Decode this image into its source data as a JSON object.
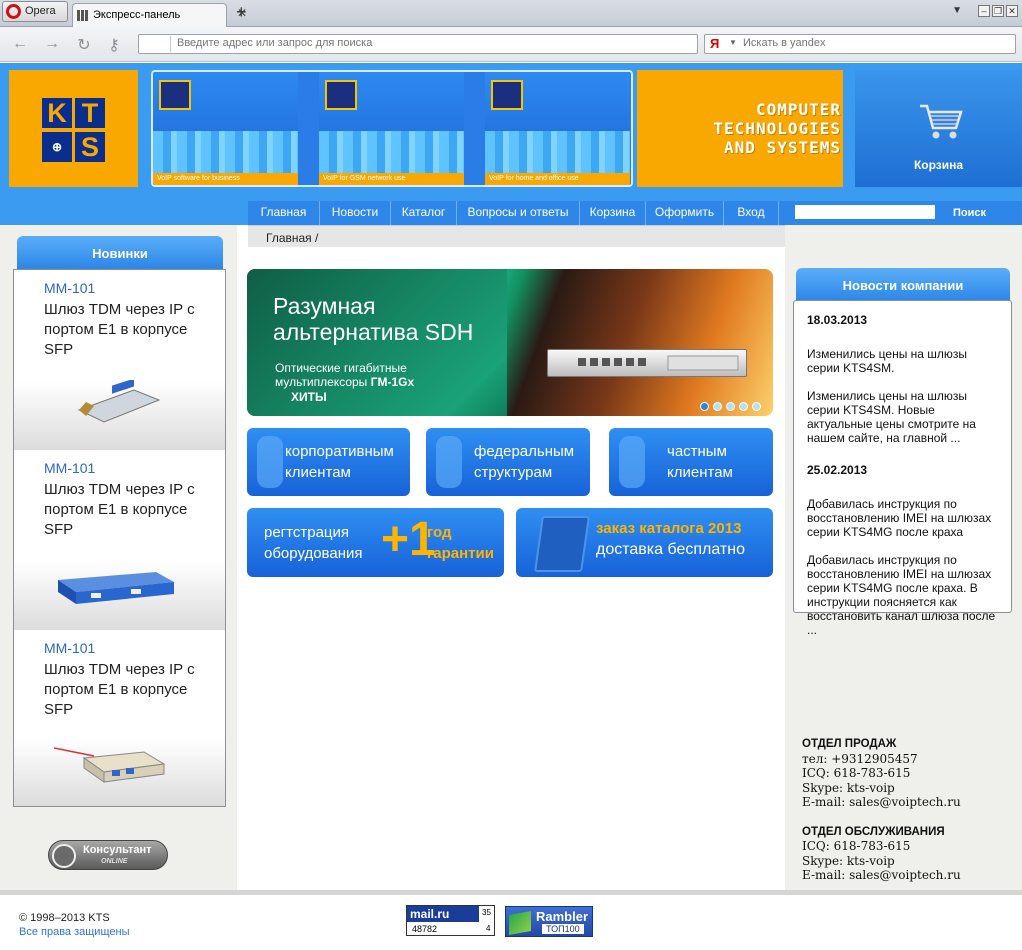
{
  "browser": {
    "menu_label": "Opera",
    "tab_title": "Экспресс-панель",
    "address_placeholder": "Введите адрес или запрос для поиска",
    "search_engine_icon": "Я",
    "search_placeholder": "Искать в yandex"
  },
  "header": {
    "logo_letters": [
      "K",
      "T",
      "S"
    ],
    "banner_captions": [
      "VoIP software for business",
      "VoIP for GSM network use",
      "VoIP for home and office use"
    ],
    "slogan": [
      "COMPUTER",
      "TECHNOLOGIES",
      "AND SYSTEMS"
    ],
    "cart_label": "Корзина"
  },
  "menu": {
    "items": [
      "Главная",
      "Новости",
      "Каталог",
      "Вопросы и ответы",
      "Корзина",
      "Оформить",
      "Вход"
    ],
    "search_button": "Поиск"
  },
  "breadcrumb": "Главная /",
  "new_items": {
    "title": "Новинки",
    "products": [
      {
        "title": "MM-101",
        "desc": "Шлюз TDM через IP с портом E1 в корпусе SFP"
      },
      {
        "title": "MM-101",
        "desc": "Шлюз TDM через IP с портом E1 в корпусе SFP"
      },
      {
        "title": "MM-101",
        "desc": "Шлюз TDM через IP с портом E1 в корпусе SFP"
      }
    ]
  },
  "consultant": {
    "label": "Консультант",
    "status": "ONLINE"
  },
  "slider": {
    "title": "Разумная альтернатива SDH",
    "subtitle": "Оптические гигабитные мультиплексоры",
    "model": "ГМ-1Gx",
    "hits": "ХИТЫ",
    "dots_active_index": 0
  },
  "client_buttons": [
    {
      "label": "корпоративным клиентам"
    },
    {
      "label": "федеральным структурам"
    },
    {
      "label": "частным клиентам"
    }
  ],
  "promo": {
    "reg_text": "регтстрация оборудования",
    "plus": "+1",
    "year": "год гарантии",
    "catalog_title": "заказ каталога 2013",
    "catalog_sub": "доставка бесплатно"
  },
  "news": {
    "title": "Новости компании",
    "items": [
      {
        "date": "18.03.2013",
        "texts": [
          "Изменились цены на шлюзы серии KTS4SM.",
          "Изменились цены на шлюзы серии KTS4SM. Новые актуальные цены смотрите на нашем сайте, на главной ..."
        ]
      },
      {
        "date": "25.02.2013",
        "texts": [
          "Добавилась инструкция по восстановлению IMEI на шлюзах серии KTS4MG после краха",
          "Добавилась инструкция по восстановлению IMEI на шлюзах серии KTS4MG после краха. В инструкции поясняется как восстановить канал шлюза после ..."
        ]
      }
    ]
  },
  "contacts": {
    "sales_title": "ОТДЕЛ ПРОДАЖ",
    "sales_lines": [
      "тел: +9312905457",
      "ICQ: 618-783-615",
      "Skype: kts-voip",
      "E-mail: sales@voiptech.ru"
    ],
    "service_title": "ОТДЕЛ ОБСЛУЖИВАНИЯ",
    "service_lines": [
      "ICQ: 618-783-615",
      "Skype: kts-voip",
      "E-mail: sales@voiptech.ru"
    ]
  },
  "footer": {
    "copyright": "© 1998–2013 KTS",
    "rights": "Все права защищены",
    "mail_counter": {
      "brand": "mail.ru",
      "visits": "48782",
      "top": "35",
      "bottom": "4"
    },
    "rambler": {
      "brand": "Rambler",
      "label": "ТОП100"
    }
  }
}
